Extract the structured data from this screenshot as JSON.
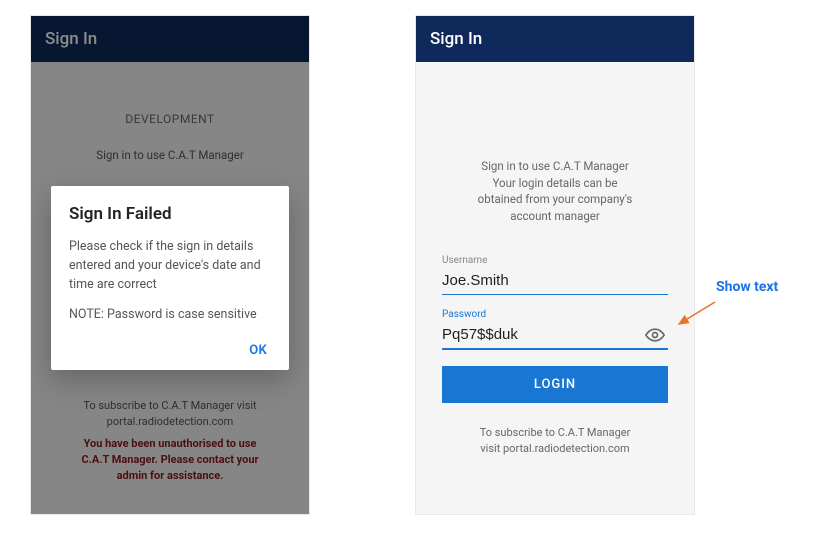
{
  "left": {
    "header_title": "Sign In",
    "bg": {
      "dev": "DEVELOPMENT",
      "signin_line": "Sign in to use C.A.T Manager",
      "subscribe_line1": "To subscribe to C.A.T Manager visit",
      "subscribe_line2": "portal.radiodetection.com",
      "unauth_line1": "You have been unauthorised to use",
      "unauth_line2": "C.A.T Manager. Please contact your",
      "unauth_line3": "admin for assistance."
    },
    "dialog": {
      "title": "Sign In Failed",
      "body1": "Please check if the sign in details entered and your device's date and time are correct",
      "body2": "NOTE: Password is case sensitive",
      "ok": "OK"
    }
  },
  "right": {
    "header_title": "Sign In",
    "intro_line1": "Sign in to use C.A.T Manager",
    "intro_line2": "Your login details can be",
    "intro_line3": "obtained from your company's",
    "intro_line4": "account manager",
    "username_label": "Username",
    "username_value": "Joe.Smith",
    "password_label": "Password",
    "password_value": "Pq57$$duk",
    "login_button": "LOGIN",
    "sub_line1": "To subscribe to C.A.T Manager",
    "sub_line2": "visit portal.radiodetection.com"
  },
  "annotation": {
    "show_text": "Show text"
  }
}
